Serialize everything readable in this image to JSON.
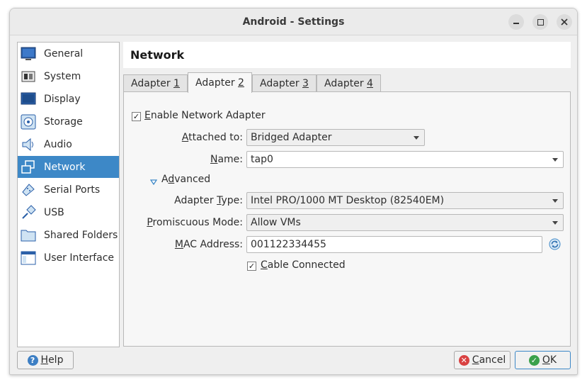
{
  "window": {
    "title": "Android - Settings"
  },
  "sidebar": {
    "items": [
      {
        "label": "General",
        "icon": "general-icon"
      },
      {
        "label": "System",
        "icon": "system-icon"
      },
      {
        "label": "Display",
        "icon": "display-icon"
      },
      {
        "label": "Storage",
        "icon": "storage-icon"
      },
      {
        "label": "Audio",
        "icon": "audio-icon"
      },
      {
        "label": "Network",
        "icon": "network-icon",
        "active": true
      },
      {
        "label": "Serial Ports",
        "icon": "serial-ports-icon"
      },
      {
        "label": "USB",
        "icon": "usb-icon"
      },
      {
        "label": "Shared Folders",
        "icon": "shared-folders-icon"
      },
      {
        "label": "User Interface",
        "icon": "user-interface-icon"
      }
    ]
  },
  "header": {
    "title": "Network"
  },
  "tabs": [
    {
      "label_prefix": "Adapter ",
      "mnemonic": "1"
    },
    {
      "label_prefix": "Adapter ",
      "mnemonic": "2",
      "active": true
    },
    {
      "label_prefix": "Adapter ",
      "mnemonic": "3"
    },
    {
      "label_prefix": "Adapter ",
      "mnemonic": "4"
    }
  ],
  "adapter": {
    "enable": {
      "mnemonic": "E",
      "rest": "nable Network Adapter",
      "checked": true
    },
    "attached_to": {
      "label_mnemonic": "A",
      "label_rest": "ttached to:",
      "value": "Bridged Adapter"
    },
    "name": {
      "label_mnemonic": "N",
      "label_rest": "ame:",
      "value": "tap0"
    },
    "advanced": {
      "prefix": "A",
      "mnemonic": "d",
      "rest": "vanced",
      "expanded": true
    },
    "adapter_type": {
      "label_pre": "Adapter ",
      "label_mnemonic": "T",
      "label_rest": "ype:",
      "value": "Intel PRO/1000 MT Desktop (82540EM)"
    },
    "promiscuous": {
      "label_mnemonic": "P",
      "label_rest": "romiscuous Mode:",
      "value": "Allow VMs"
    },
    "mac": {
      "label_mnemonic": "M",
      "label_rest": "AC Address:",
      "value": "001122334455"
    },
    "cable": {
      "mnemonic": "C",
      "rest": "able Connected",
      "checked": true
    }
  },
  "buttons": {
    "help": {
      "mnemonic": "H",
      "rest": "elp"
    },
    "cancel": {
      "mnemonic": "C",
      "rest": "ancel"
    },
    "ok": {
      "mnemonic": "O",
      "rest": "K"
    }
  },
  "colors": {
    "accent": "#3d88c7",
    "cancel_icon": "#d94141",
    "ok_icon": "#3aa14b",
    "help_icon": "#3d7fc4"
  }
}
